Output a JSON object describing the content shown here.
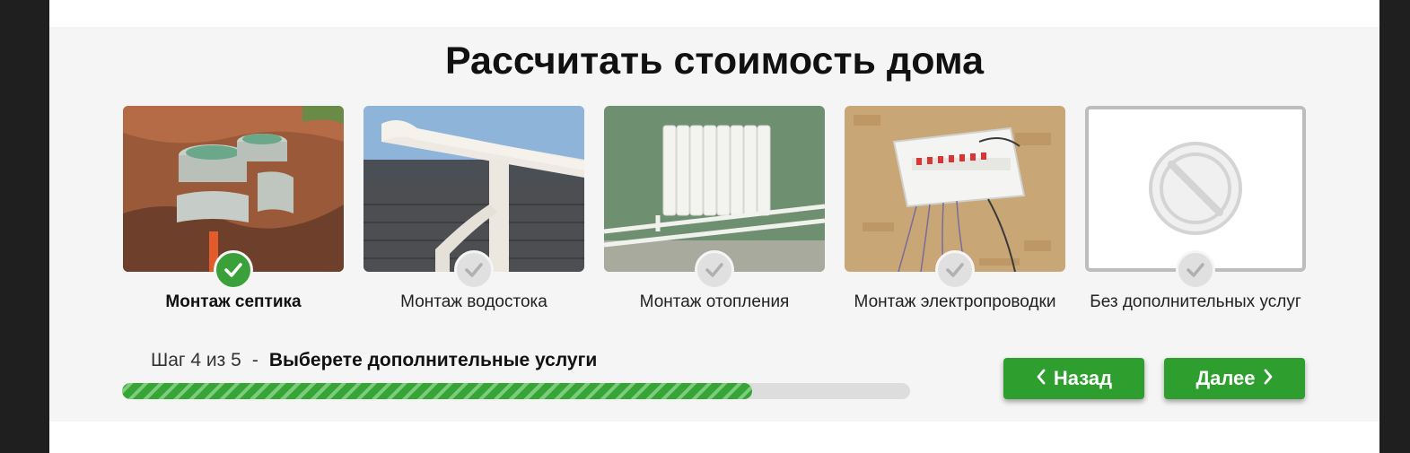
{
  "title": "Рассчитать стоимость дома",
  "options": [
    {
      "label": "Монтаж септика",
      "selected": true,
      "image": "septic-tank-photo"
    },
    {
      "label": "Монтаж водостока",
      "selected": false,
      "image": "gutter-photo"
    },
    {
      "label": "Монтаж отопления",
      "selected": false,
      "image": "radiator-photo"
    },
    {
      "label": "Монтаж электропроводки",
      "selected": false,
      "image": "electrical-panel-photo"
    },
    {
      "label": "Без дополнительных услуг",
      "selected": false,
      "image": "prohibited-icon"
    }
  ],
  "step": {
    "text": "Шаг 4 из 5",
    "separator": "-",
    "instruction": "Выберете дополнительные услуги",
    "progress_fraction": 0.8
  },
  "buttons": {
    "back": "Назад",
    "next": "Далее"
  },
  "colors": {
    "accent": "#2e9e2e",
    "panel_bg": "#f5f5f5",
    "check_inactive": "#e0e0e0"
  }
}
